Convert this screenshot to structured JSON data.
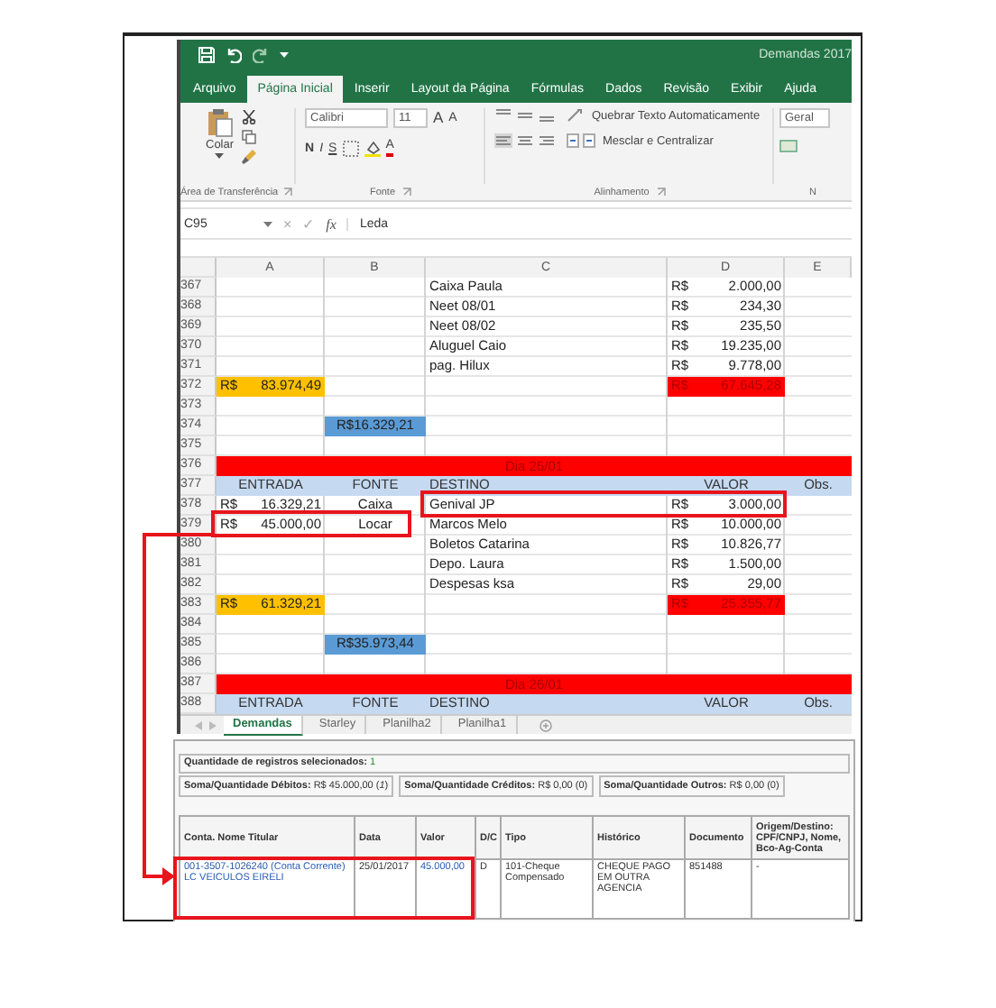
{
  "window": {
    "title": "Demandas 2017"
  },
  "tabs": [
    {
      "label": "Arquivo",
      "selected": false
    },
    {
      "label": "Página Inicial",
      "selected": true
    },
    {
      "label": "Inserir",
      "selected": false
    },
    {
      "label": "Layout da Página",
      "selected": false
    },
    {
      "label": "Fórmulas",
      "selected": false
    },
    {
      "label": "Dados",
      "selected": false
    },
    {
      "label": "Revisão",
      "selected": false
    },
    {
      "label": "Exibir",
      "selected": false
    },
    {
      "label": "Ajuda",
      "selected": false
    }
  ],
  "ribbon": {
    "clipboard": {
      "paste_label": "Colar",
      "group_label": "Área de Transferência"
    },
    "font": {
      "name": "Calibri",
      "size": "11",
      "grow": "A",
      "shrink": "A",
      "bold": "N",
      "italic": "I",
      "underline": "S",
      "color_letter": "A",
      "group_label": "Fonte"
    },
    "alignment": {
      "wrap": "Quebrar Texto Automaticamente",
      "merge": "Mesclar e Centralizar",
      "group_label": "Alinhamento"
    },
    "number": {
      "format": "Geral",
      "group_label": "N"
    }
  },
  "formula_bar": {
    "cell": "C95",
    "cancel": "×",
    "enter": "✓",
    "function": "fx",
    "content": "Leda"
  },
  "sheet": {
    "columns": [
      "A",
      "B",
      "C",
      "D",
      "E"
    ],
    "rows": [
      {
        "number": "367",
        "kind": "data",
        "c": {
          "text": "Caixa Paula"
        },
        "d": {
          "currency": "R$",
          "amount": "2.000,00"
        }
      },
      {
        "number": "368",
        "kind": "data",
        "c": {
          "text": "Neet 08/01"
        },
        "d": {
          "currency": "R$",
          "amount": "234,30"
        }
      },
      {
        "number": "369",
        "kind": "data",
        "c": {
          "text": "Neet 08/02"
        },
        "d": {
          "currency": "R$",
          "amount": "235,50"
        }
      },
      {
        "number": "370",
        "kind": "data",
        "c": {
          "text": "Aluguel Caio"
        },
        "d": {
          "currency": "R$",
          "amount": "19.235,00"
        }
      },
      {
        "number": "371",
        "kind": "data",
        "c": {
          "text": "pag. Hilux"
        },
        "d": {
          "currency": "R$",
          "amount": "9.778,00"
        }
      },
      {
        "number": "372",
        "kind": "data",
        "a": {
          "currency": "R$",
          "amount": "83.974,49",
          "color": "#ffc000"
        },
        "d": {
          "currency": "R$",
          "amount": "67.645,28",
          "color": "#ff0000"
        }
      },
      {
        "number": "373",
        "kind": "data"
      },
      {
        "number": "374",
        "kind": "data",
        "b": {
          "text": "R$16.329,21",
          "color": "#5b9bd5"
        }
      },
      {
        "number": "375",
        "kind": "data"
      },
      {
        "number": "376",
        "kind": "banner",
        "text": "Dia 25/01",
        "color": "#ff0000"
      },
      {
        "number": "377",
        "kind": "header",
        "color": "#c5d9f1",
        "a": {
          "text": "ENTRADA"
        },
        "b": {
          "text": "FONTE"
        },
        "c": {
          "text": "DESTINO"
        },
        "d": {
          "text": "VALOR"
        },
        "e": {
          "text": "Obs."
        }
      },
      {
        "number": "378",
        "kind": "data",
        "a": {
          "currency": "R$",
          "amount": "16.329,21"
        },
        "b": {
          "text": "Caixa"
        },
        "c": {
          "text": "Genival JP"
        },
        "d": {
          "currency": "R$",
          "amount": "3.000,00"
        }
      },
      {
        "number": "379",
        "kind": "data",
        "a": {
          "currency": "R$",
          "amount": "45.000,00"
        },
        "b": {
          "text": "Locar"
        },
        "c": {
          "text": "Marcos Melo"
        },
        "d": {
          "currency": "R$",
          "amount": "10.000,00"
        }
      },
      {
        "number": "380",
        "kind": "data",
        "c": {
          "text": "Boletos Catarina"
        },
        "d": {
          "currency": "R$",
          "amount": "10.826,77"
        }
      },
      {
        "number": "381",
        "kind": "data",
        "c": {
          "text": "Depo. Laura"
        },
        "d": {
          "currency": "R$",
          "amount": "1.500,00"
        }
      },
      {
        "number": "382",
        "kind": "data",
        "c": {
          "text": "Despesas ksa"
        },
        "d": {
          "currency": "R$",
          "amount": "29,00"
        }
      },
      {
        "number": "383",
        "kind": "data",
        "a": {
          "currency": "R$",
          "amount": "61.329,21",
          "color": "#ffc000"
        },
        "d": {
          "currency": "R$",
          "amount": "25.355,77",
          "color": "#ff0000"
        }
      },
      {
        "number": "384",
        "kind": "data"
      },
      {
        "number": "385",
        "kind": "data",
        "b": {
          "text": "R$35.973,44",
          "color": "#5b9bd5"
        }
      },
      {
        "number": "386",
        "kind": "data"
      },
      {
        "number": "387",
        "kind": "banner",
        "text": "Dia 26/01",
        "color": "#ff0000"
      },
      {
        "number": "388",
        "kind": "header",
        "color": "#c5d9f1",
        "a": {
          "text": "ENTRADA"
        },
        "b": {
          "text": "FONTE"
        },
        "c": {
          "text": "DESTINO"
        },
        "d": {
          "text": "VALOR"
        },
        "e": {
          "text": "Obs."
        }
      }
    ]
  },
  "sheet_tabs": [
    {
      "label": "Demandas",
      "selected": true
    },
    {
      "label": "Starley",
      "selected": false
    },
    {
      "label": "Planilha2",
      "selected": false
    },
    {
      "label": "Planilha1",
      "selected": false
    }
  ],
  "statement": {
    "selection": {
      "label": "Quantidade de registros selecionados:",
      "value": "1"
    },
    "totals": [
      "**Soma/Quantidade Débitos:** R$ 45.000,00 (*1*)",
      "**Soma/Quantidade Créditos:** R$ 0,00 (0)",
      "**Soma/Quantidade Outros:** R$ 0,00 (0)"
    ],
    "columns": [
      "Conta. Nome Titular",
      "Data",
      "Valor",
      "D/C",
      "Tipo",
      "Histórico",
      "Documento",
      "Origem/Destino: CPF/CNPJ, Nome, Bco-Ag-Conta"
    ],
    "rows": [
      {
        "cells": [
          {
            "text": "001-3507-1026240 (Conta Corrente) LC VEICULOS EIRELI",
            "link": true
          },
          {
            "text": "25/01/2017",
            "link": false
          },
          {
            "text": "45.000,00",
            "link": true
          },
          {
            "text": "D",
            "link": false
          },
          {
            "text": "101-Cheque Compensado",
            "link": false
          },
          {
            "text": "CHEQUE PAGO EM OUTRA AGENCIA",
            "link": false
          },
          {
            "text": "851488",
            "link": false
          },
          {
            "text": "-",
            "link": false
          }
        ]
      }
    ]
  }
}
